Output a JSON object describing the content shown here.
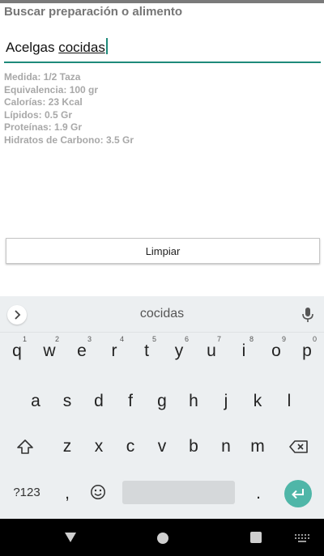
{
  "screen": {
    "title": "Buscar preparación o alimento"
  },
  "search": {
    "prefix": "Acelgas ",
    "typed": "cocidas"
  },
  "nutrition": [
    "Medida: 1/2 Taza",
    "Equivalencia: 100 gr",
    "Calorías: 23  Kcal",
    "Lípidos: 0.5 Gr",
    "Proteínas: 1.9 Gr",
    "Hidratos de Carbono: 3.5 Gr"
  ],
  "clear_button": {
    "label": "Limpiar"
  },
  "keyboard": {
    "suggestion": "cocidas",
    "expand_icon": "chevron-right-icon",
    "mic_icon": "microphone-icon",
    "row1": [
      {
        "key": "q",
        "hint": "1"
      },
      {
        "key": "w",
        "hint": "2"
      },
      {
        "key": "e",
        "hint": "3"
      },
      {
        "key": "r",
        "hint": "4"
      },
      {
        "key": "t",
        "hint": "5"
      },
      {
        "key": "y",
        "hint": "6"
      },
      {
        "key": "u",
        "hint": "7"
      },
      {
        "key": "i",
        "hint": "8"
      },
      {
        "key": "o",
        "hint": "9"
      },
      {
        "key": "p",
        "hint": "0"
      }
    ],
    "row2": [
      "a",
      "s",
      "d",
      "f",
      "g",
      "h",
      "j",
      "k",
      "l"
    ],
    "row3": [
      "z",
      "x",
      "c",
      "v",
      "b",
      "n",
      "m"
    ],
    "symbols_label": "?123",
    "comma": ",",
    "period": "."
  },
  "colors": {
    "accent": "#1e8a7a",
    "enter": "#4fb6a8",
    "keyboard_bg": "#eceff1"
  }
}
